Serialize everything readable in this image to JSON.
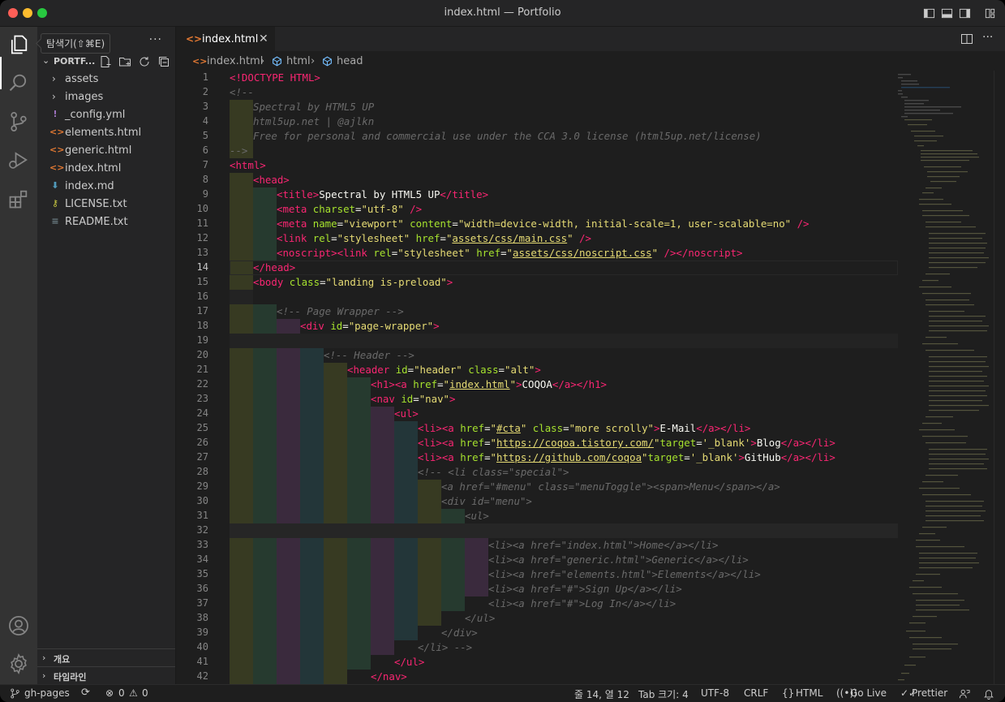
{
  "window": {
    "title": "index.html — Portfolio"
  },
  "tooltip": "탐색기(⇧⌘E)",
  "sidebar": {
    "section": "PORTF...",
    "items": [
      {
        "label": "assets",
        "type": "folder"
      },
      {
        "label": "images",
        "type": "folder"
      },
      {
        "label": "_config.yml",
        "type": "yml"
      },
      {
        "label": "elements.html",
        "type": "html"
      },
      {
        "label": "generic.html",
        "type": "html"
      },
      {
        "label": "index.html",
        "type": "html"
      },
      {
        "label": "index.md",
        "type": "md"
      },
      {
        "label": "LICENSE.txt",
        "type": "license"
      },
      {
        "label": "README.txt",
        "type": "txt"
      }
    ],
    "bottom_sections": [
      "개요",
      "타임라인"
    ]
  },
  "tab": {
    "label": "index.html"
  },
  "breadcrumb": {
    "file": "index.html",
    "seg1": "html",
    "seg2": "head"
  },
  "editor": {
    "lines": [
      {
        "n": "1"
      },
      {
        "n": "2"
      },
      {
        "n": "3"
      },
      {
        "n": "4"
      },
      {
        "n": "5"
      },
      {
        "n": "6"
      },
      {
        "n": "7"
      },
      {
        "n": "8"
      },
      {
        "n": "9"
      },
      {
        "n": "10"
      },
      {
        "n": "11"
      },
      {
        "n": "12"
      },
      {
        "n": "13"
      },
      {
        "n": "14"
      },
      {
        "n": "15"
      },
      {
        "n": "16"
      },
      {
        "n": "17"
      },
      {
        "n": "18"
      },
      {
        "n": "19"
      },
      {
        "n": "20"
      },
      {
        "n": "21"
      },
      {
        "n": "22"
      },
      {
        "n": "23"
      },
      {
        "n": "24"
      },
      {
        "n": "25"
      },
      {
        "n": "26"
      },
      {
        "n": "27"
      },
      {
        "n": "28"
      },
      {
        "n": "29"
      },
      {
        "n": "30"
      },
      {
        "n": "31"
      },
      {
        "n": "32"
      },
      {
        "n": "33"
      },
      {
        "n": "34"
      },
      {
        "n": "35"
      },
      {
        "n": "36"
      },
      {
        "n": "37"
      },
      {
        "n": "38"
      },
      {
        "n": "39"
      },
      {
        "n": "40"
      },
      {
        "n": "41"
      },
      {
        "n": "42"
      }
    ],
    "code": {
      "l1": "<!DOCTYPE HTML>",
      "l2": "<!--",
      "l3": "Spectral by HTML5 UP",
      "l4": "html5up.net | @ajlkn",
      "l5": "Free for personal and commercial use under the CCA 3.0 license (html5up.net/license)",
      "l6": "-->",
      "l7": "<html>",
      "l8": "<head>",
      "l9a": "<title>",
      "l9b": "Spectral by HTML5 UP",
      "l9c": "</title>",
      "l10a": "<meta ",
      "l10b": "charset",
      "l10c": "=",
      "l10d": "\"utf-8\"",
      "l10e": " />",
      "l11a": "<meta ",
      "l11b": "name",
      "l11c": "=",
      "l11d": "\"viewport\"",
      "l11e": " content",
      "l11f": "\"width=device-width, initial-scale=1, user-scalable=no\"",
      "l11g": " />",
      "l12a": "<link ",
      "l12b": "rel",
      "l12c": "\"stylesheet\"",
      "l12d": " href",
      "l12e": "assets/css/main.css",
      "l12f": " />",
      "l13a": "<noscript><link ",
      "l13b": "assets/css/noscript.css",
      "l13c": " /></noscript>",
      "l14": "</head>",
      "l15a": "<body ",
      "l15b": "class",
      "l15c": "\"landing is-preload\"",
      "l15d": ">",
      "l17": "<!-- Page Wrapper -->",
      "l18a": "<div ",
      "l18b": "id",
      "l18c": "\"page-wrapper\"",
      "l20": "<!-- Header -->",
      "l21a": "<header ",
      "l21c": "\"header\"",
      "l21e": "\"alt\"",
      "l22a": "<h1><a ",
      "l22b": "href",
      "l22c": "index.html",
      "l22d": ">",
      "l22e": "COQOA",
      "l22f": "</a></h1>",
      "l23a": "<nav ",
      "l23c": "\"nav\"",
      "l24": "<ul>",
      "l25a": "<li><a ",
      "l25c": "#cta",
      "l25e": "\"more scrolly\"",
      "l25f": "E-Mail",
      "l25g": "</a></li>",
      "l26c": "https://coqoa.tistory.com/",
      "l26d": "target",
      "l26e": "'_blank'",
      "l26f": "Blog",
      "l27c": "https://github.com/coqoa",
      "l27f": "GitHub",
      "l28": "<!-- <li class=\"special\">",
      "l29": "<a href=\"#menu\" class=\"menuToggle\"><span>Menu</span></a>",
      "l30": "<div id=\"menu\">",
      "l31": "<ul>",
      "l33": "<li><a href=\"index.html\">Home</a></li>",
      "l34": "<li><a href=\"generic.html\">Generic</a></li>",
      "l35": "<li><a href=\"elements.html\">Elements</a></li>",
      "l36": "<li><a href=\"#\">Sign Up</a></li>",
      "l37": "<li><a href=\"#\">Log In</a></li>",
      "l38": "</ul>",
      "l39": "</div>",
      "l40": "</li> -->",
      "l41": "</ul>",
      "l42": "</nav>"
    }
  },
  "statusbar": {
    "branch": "gh-pages",
    "errors": "0",
    "warnings": "0",
    "position": "줄 14, 열 12",
    "tab_size": "Tab 크기: 4",
    "encoding": "UTF-8",
    "eol": "CRLF",
    "language": "HTML",
    "golive": "Go Live",
    "prettier": "Prettier"
  },
  "colors": {
    "accent_orange": "#e37933",
    "statusbar_bg": "#1e1e1e",
    "editor_bg": "#1e1e1e"
  }
}
